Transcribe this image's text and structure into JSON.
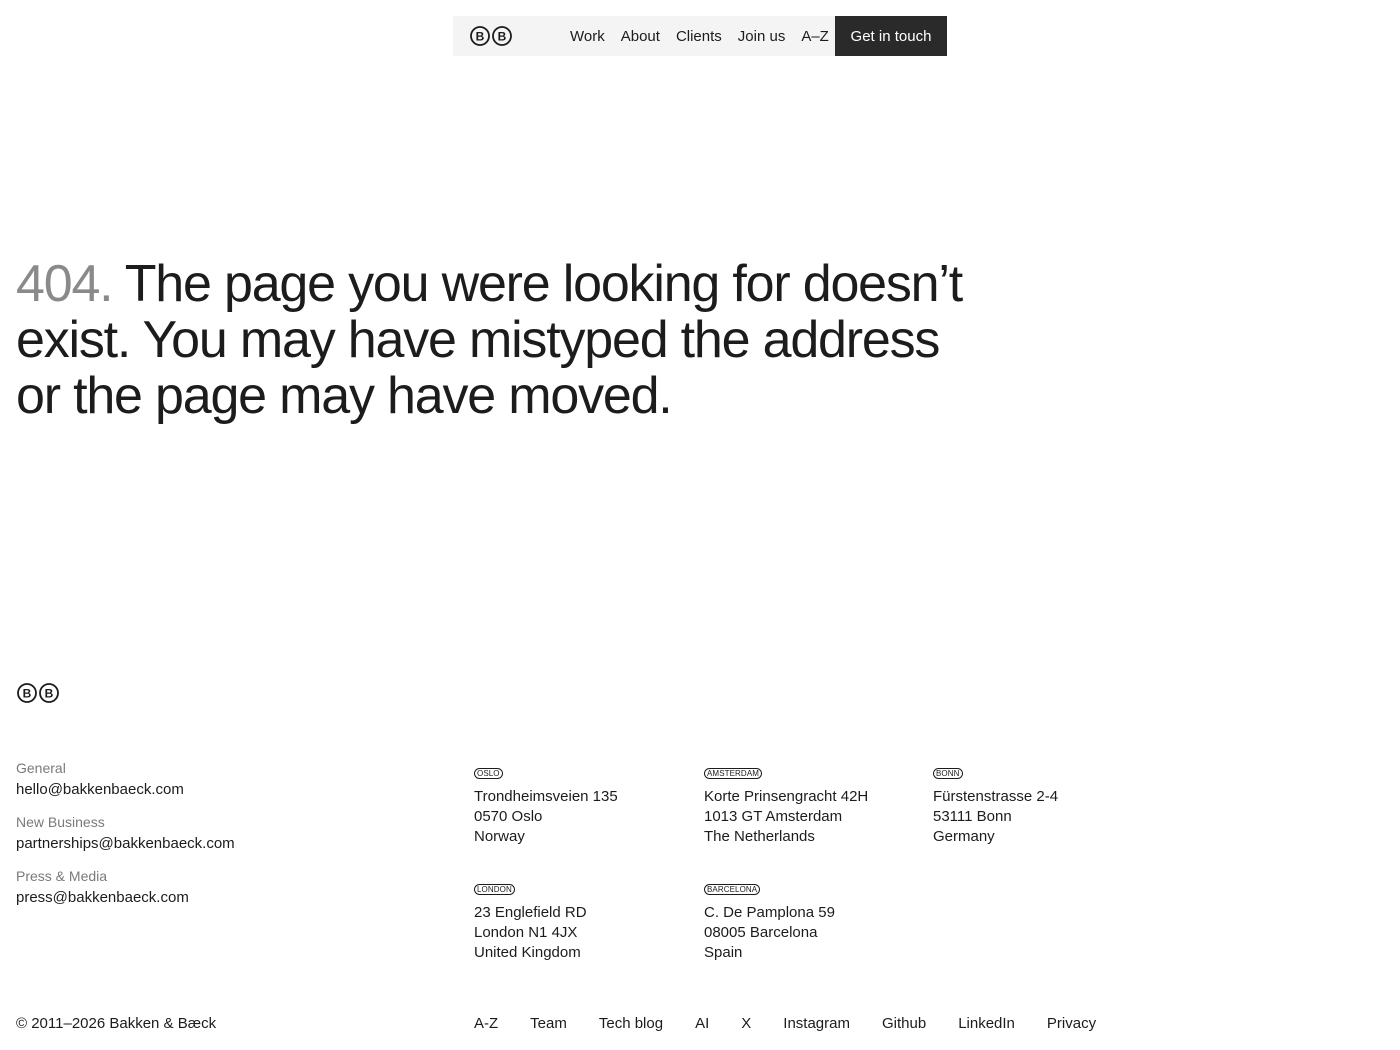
{
  "nav": {
    "logo_icon": "bb-logo-icon",
    "links": [
      "Work",
      "About",
      "Clients",
      "Join us",
      "A–Z"
    ],
    "cta": "Get in touch"
  },
  "hero": {
    "code": "404.",
    "message": "The page you were looking for doesn’t exist. You may have mistyped the address or the page may have moved."
  },
  "footer": {
    "logo_icon": "bb-logo-icon",
    "contacts": [
      {
        "label": "General",
        "email": "hello@bakkenbaeck.com"
      },
      {
        "label": "New Business",
        "email": "partnerships@bakkenbaeck.com"
      },
      {
        "label": "Press & Media",
        "email": "press@bakkenbaeck.com"
      }
    ],
    "offices": [
      {
        "city": "OSLO",
        "lines": [
          "Trondheimsveien 135",
          "0570 Oslo",
          "Norway"
        ]
      },
      {
        "city": "AMSTERDAM",
        "lines": [
          "Korte Prinsengracht 42H",
          "1013 GT Amsterdam",
          "The Netherlands"
        ]
      },
      {
        "city": "BONN",
        "lines": [
          "Fürstenstrasse 2-4",
          "53111 Bonn",
          "Germany"
        ]
      },
      {
        "city": "LONDON",
        "lines": [
          "23 Englefield RD",
          "London N1 4JX",
          "United Kingdom"
        ]
      },
      {
        "city": "BARCELONA",
        "lines": [
          "C. De Pamplona 59",
          "08005 Barcelona",
          "Spain"
        ]
      }
    ],
    "copyright": "© 2011–2026 Bakken & Bæck",
    "links": [
      "A-Z",
      "Team",
      "Tech blog",
      "AI",
      "X",
      "Instagram",
      "Github",
      "LinkedIn",
      "Privacy"
    ]
  }
}
